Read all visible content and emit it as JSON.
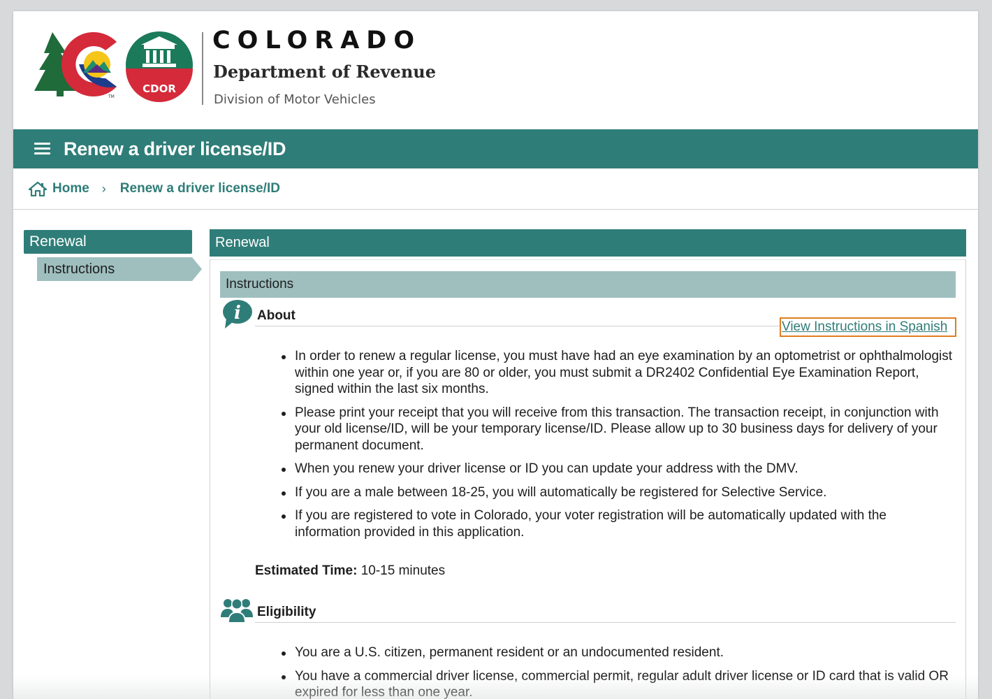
{
  "header": {
    "brand_title": "COLORADO",
    "department": "Department of Revenue",
    "division": "Division of Motor Vehicles",
    "cdor_badge": "CDOR",
    "tm_mark": "TM"
  },
  "titlebar": {
    "title": "Renew a driver license/ID"
  },
  "breadcrumb": {
    "home": "Home",
    "separator": "›",
    "current": "Renew a driver license/ID"
  },
  "sidebar": {
    "header": "Renewal",
    "items": [
      {
        "label": "Instructions"
      }
    ]
  },
  "main": {
    "header": "Renewal",
    "subheader": "Instructions",
    "spanish_link": "View Instructions in Spanish",
    "about": {
      "title": "About",
      "bullets": [
        "In order to renew a regular license, you must have had an eye examination by an optometrist or ophthalmologist within one year or, if you are 80 or older, you must submit a DR2402 Confidential Eye Examination Report, signed within the last six months.",
        "Please print your receipt that you will receive from this transaction. The transaction receipt, in conjunction with your old license/ID, will be your temporary license/ID. Please allow up to 30 business days for delivery of your permanent document.",
        "When you renew your driver license or ID you can update your address with the DMV.",
        "If you are a male between 18-25, you will automatically be registered for Selective Service.",
        "If you are registered to vote in Colorado, your voter registration will be automatically updated with the information provided in this application."
      ]
    },
    "estimated_time": {
      "label": "Estimated Time:",
      "value": "10-15 minutes"
    },
    "eligibility": {
      "title": "Eligibility",
      "bullets": [
        "You are a U.S. citizen, permanent resident or an undocumented resident.",
        "You have a commercial driver license, commercial permit, regular adult driver license or ID card that is valid OR expired for less than one year."
      ]
    }
  },
  "colors": {
    "teal": "#2f7d78",
    "teal_light": "#9fbfbf",
    "focus_orange": "#e07c1f",
    "logo_red": "#d42a3a",
    "logo_blue": "#1e3c8c",
    "logo_yellow": "#f5c518",
    "logo_green": "#1f6b3a",
    "cdor_green": "#1a7a5a"
  }
}
